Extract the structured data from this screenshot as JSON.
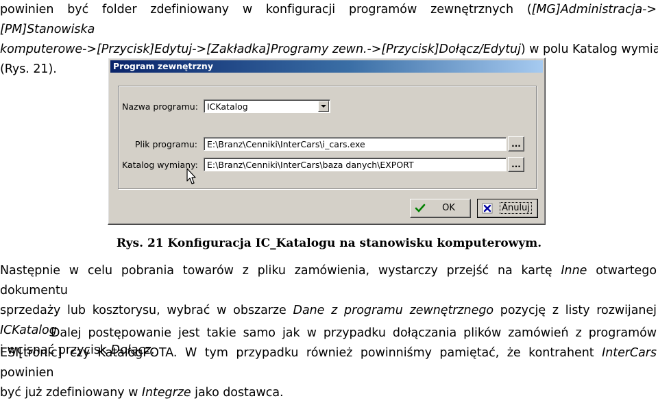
{
  "intro": {
    "line1_a": "powinien być folder zdefiniowany w konfiguracji programów zewnętrznych (",
    "line1_b": "[MG]Administracja->[PM]Stanowiska",
    "line2_a": "komputerowe->[Przycisk]Edytuj->[Zakładka]Programy zewn.->[Przycisk]Dołącz/Edytuj",
    "line2_b": ") w polu Katalog wymiany",
    "line3": "(Rys. 21)."
  },
  "dialog": {
    "title": "Program zewnętrzny",
    "program_name_label": "Nazwa programu:",
    "program_name_value": "ICKatalog",
    "program_file_label": "Plik programu:",
    "program_file_value": "E:\\Branz\\Cenniki\\InterCars\\i_cars.exe",
    "exchange_dir_label": "Katalog wymiany:",
    "exchange_dir_value": "E:\\Branz\\Cenniki\\InterCars\\baza danych\\EXPORT",
    "browse_label": "...",
    "ok_label": "OK",
    "cancel_label": "Anuluj"
  },
  "caption": "Rys. 21 Konfiguracja IC_Katalogu na stanowisku komputerowym.",
  "para1": {
    "l1_a": "Następnie w celu pobrania towarów z pliku zamówienia, wystarczy przejść na kartę ",
    "l1_b": "Inne",
    "l1_c": " otwartego dokumentu",
    "l2_a": "sprzedaży lub kosztorysu, wybrać w obszarze ",
    "l2_b": "Dane z programu zewnętrznego",
    "l2_c": " pozycję z listy rozwijanej ",
    "l2_d": "ICKatalog",
    "l3_a": "i wcisnąć przycisk ",
    "l3_b": "Dołącz",
    "l3_c": "."
  },
  "para2": {
    "l1": "Dalej postępowanie jest takie samo jak w przypadku dołączania plików zamówień z programów",
    "l2_a": "ESI[tronic] czy KatalogFOTA. W tym przypadku również powinniśmy pamiętać, że kontrahent ",
    "l2_b": "InterCars",
    "l2_c": " powinien",
    "l3_a": "być już zdefiniowany w ",
    "l3_b": "Integrze",
    "l3_c": " jako dostawca."
  }
}
